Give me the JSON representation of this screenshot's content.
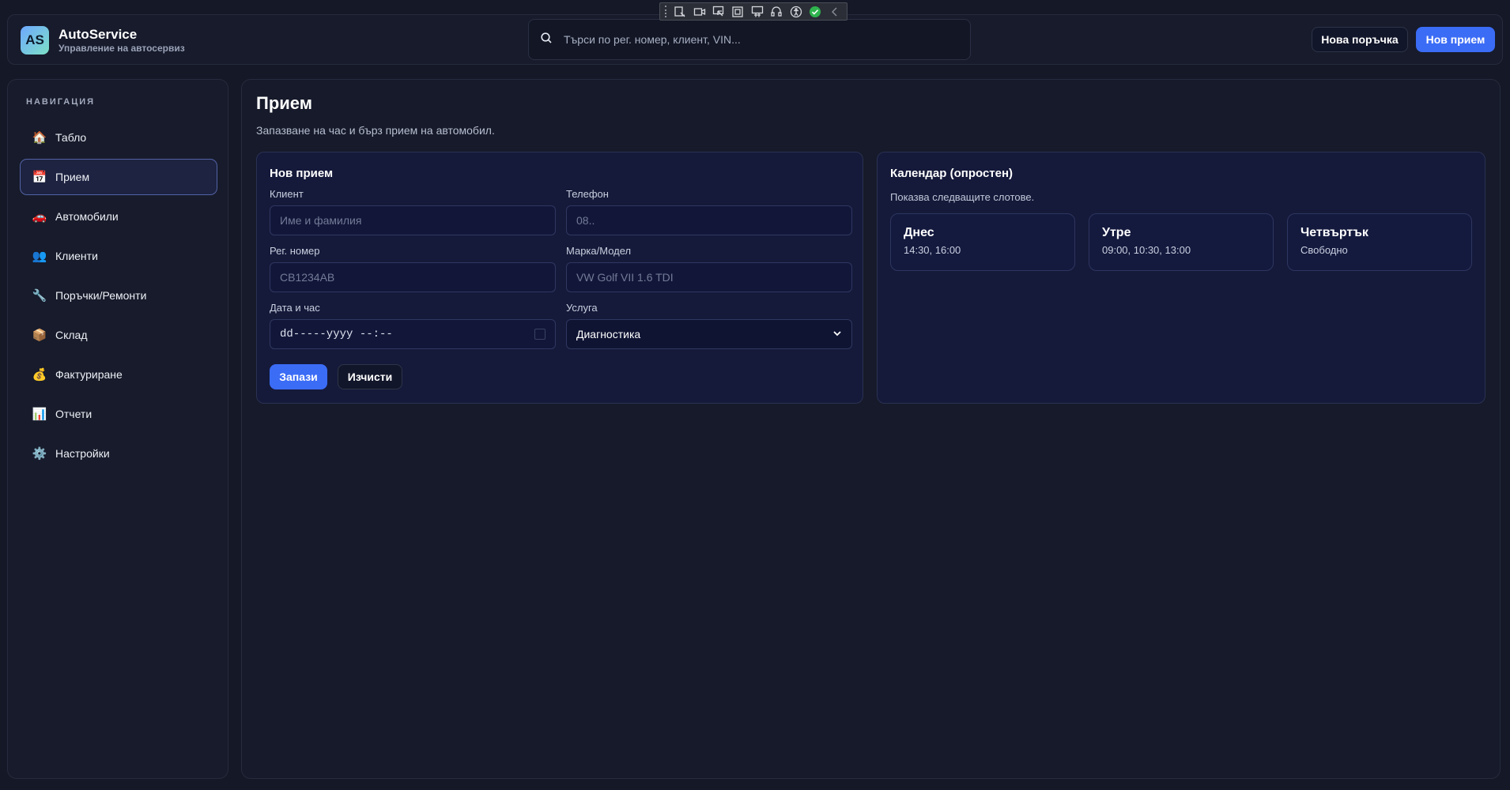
{
  "header": {
    "logo_text": "AS",
    "app_title": "AutoService",
    "app_subtitle": "Управление на автосервиз",
    "search_placeholder": "Търси по рег. номер, клиент, VIN...",
    "new_order_label": "Нова поръчка",
    "new_intake_label": "Нов прием"
  },
  "sidebar": {
    "title": "НАВИГАЦИЯ",
    "items": [
      {
        "label": "Табло",
        "icon": "house-icon",
        "glyph": "🏠",
        "active": false
      },
      {
        "label": "Прием",
        "icon": "calendar-icon",
        "glyph": "📅",
        "active": true
      },
      {
        "label": "Автомобили",
        "icon": "car-icon",
        "glyph": "🚗",
        "active": false
      },
      {
        "label": "Клиенти",
        "icon": "users-icon",
        "glyph": "👥",
        "active": false
      },
      {
        "label": "Поръчки/Ремонти",
        "icon": "wrench-icon",
        "glyph": "🔧",
        "active": false
      },
      {
        "label": "Склад",
        "icon": "package-icon",
        "glyph": "📦",
        "active": false
      },
      {
        "label": "Фактуриране",
        "icon": "money-bag-icon",
        "glyph": "💰",
        "active": false
      },
      {
        "label": "Отчети",
        "icon": "bar-chart-icon",
        "glyph": "📊",
        "active": false
      },
      {
        "label": "Настройки",
        "icon": "gear-icon",
        "glyph": "⚙️",
        "active": false
      }
    ]
  },
  "main": {
    "title": "Прием",
    "subtitle": "Запазване на час и бърз прием на автомобил.",
    "form": {
      "title": "Нов прием",
      "client_label": "Клиент",
      "client_placeholder": "Име и фамилия",
      "phone_label": "Телефон",
      "phone_placeholder": "08..",
      "reg_label": "Рег. номер",
      "reg_placeholder": "CB1234AB",
      "make_label": "Марка/Модел",
      "make_placeholder": "VW Golf VII 1.6 TDI",
      "date_label": "Дата и час",
      "date_value": "dd-----yyyy --:--",
      "service_label": "Услуга",
      "service_value": "Диагностика",
      "save_label": "Запази",
      "clear_label": "Изчисти"
    },
    "calendar": {
      "title": "Календар (опростен)",
      "subtitle": "Показва следващите слотове.",
      "slots": [
        {
          "day": "Днес",
          "times": "14:30, 16:00"
        },
        {
          "day": "Утре",
          "times": "09:00, 10:30, 13:00"
        },
        {
          "day": "Четвъртък",
          "times": "Свободно"
        }
      ]
    }
  },
  "colors": {
    "accent": "#3b6cf6",
    "background": "#151826",
    "card": "#151a3a"
  }
}
